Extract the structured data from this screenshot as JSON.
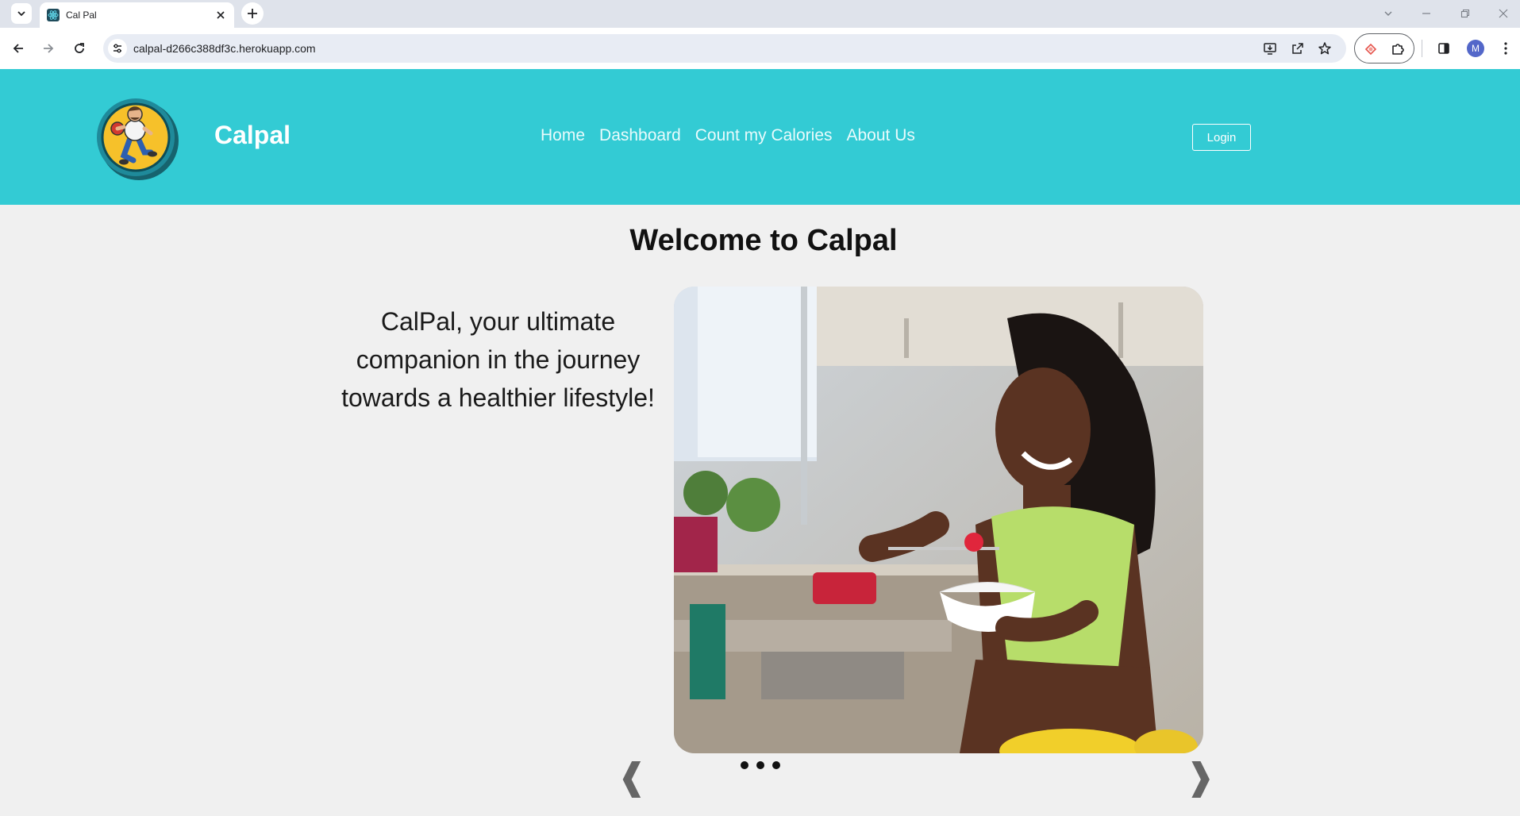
{
  "browser": {
    "tab": {
      "title": "Cal Pal"
    },
    "url": "calpal-d266c388df3c.herokuapp.com",
    "profile_initial": "M"
  },
  "header": {
    "brand": "Calpal",
    "nav": [
      "Home",
      "Dashboard",
      "Count my Calories",
      "About Us"
    ],
    "login_label": "Login"
  },
  "main": {
    "title": "Welcome to Calpal",
    "intro": "CalPal, your ultimate companion in the journey towards a healthier lifestyle!",
    "carousel": {
      "slide_count": 3,
      "prev_label": "❰",
      "next_label": "❱"
    }
  },
  "colors": {
    "header_bg": "#33cbd4",
    "page_bg": "#f0f0f0"
  }
}
